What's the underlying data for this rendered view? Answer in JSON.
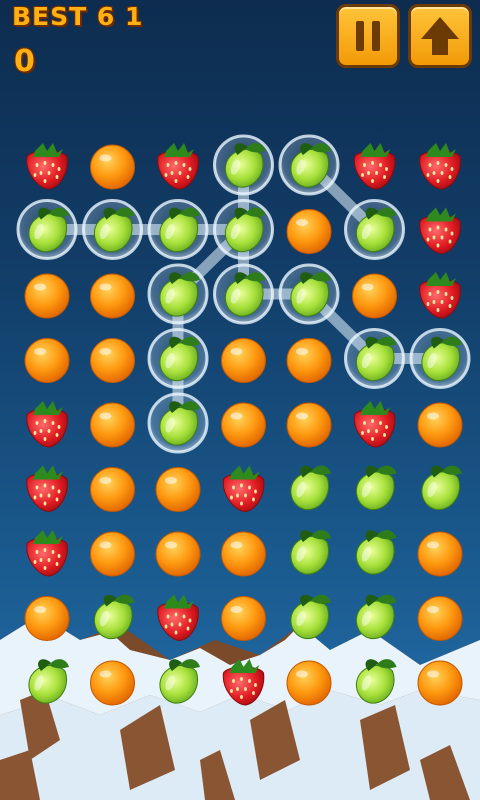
{
  "hud": {
    "best_label": "BEST 6 1",
    "score": "0",
    "pause_icon": "pause-icon",
    "up_icon": "up-arrow-icon"
  },
  "colors": {
    "accent": "#ffb114",
    "button": "#f29a07"
  },
  "board": {
    "rows": 9,
    "cols": 7,
    "grid": [
      [
        "strawberry",
        "orange",
        "strawberry",
        "lime",
        "lime",
        "strawberry",
        "strawberry"
      ],
      [
        "lime",
        "lime",
        "lime",
        "lime",
        "orange",
        "lime",
        "strawberry"
      ],
      [
        "orange",
        "orange",
        "lime",
        "lime",
        "lime",
        "orange",
        "strawberry"
      ],
      [
        "orange",
        "orange",
        "lime",
        "orange",
        "orange",
        "lime",
        "lime"
      ],
      [
        "strawberry",
        "orange",
        "lime",
        "orange",
        "orange",
        "strawberry",
        "orange"
      ],
      [
        "strawberry",
        "orange",
        "orange",
        "strawberry",
        "lime",
        "lime",
        "lime"
      ],
      [
        "strawberry",
        "orange",
        "orange",
        "orange",
        "lime",
        "lime",
        "orange"
      ],
      [
        "orange",
        "lime",
        "strawberry",
        "orange",
        "lime",
        "lime",
        "orange"
      ],
      [
        "lime",
        "orange",
        "lime",
        "strawberry",
        "orange",
        "lime",
        "orange"
      ]
    ],
    "selected": [
      [
        0,
        3
      ],
      [
        0,
        4
      ],
      [
        1,
        0
      ],
      [
        1,
        1
      ],
      [
        1,
        2
      ],
      [
        1,
        3
      ],
      [
        1,
        5
      ],
      [
        2,
        2
      ],
      [
        2,
        3
      ],
      [
        2,
        4
      ],
      [
        3,
        2
      ],
      [
        3,
        5
      ],
      [
        3,
        6
      ],
      [
        4,
        2
      ]
    ],
    "links": [
      [
        [
          1,
          0
        ],
        [
          1,
          1
        ]
      ],
      [
        [
          1,
          1
        ],
        [
          1,
          2
        ]
      ],
      [
        [
          1,
          2
        ],
        [
          1,
          3
        ]
      ],
      [
        [
          0,
          3
        ],
        [
          1,
          3
        ]
      ],
      [
        [
          0,
          4
        ],
        [
          1,
          5
        ]
      ],
      [
        [
          1,
          3
        ],
        [
          2,
          3
        ]
      ],
      [
        [
          1,
          3
        ],
        [
          2,
          2
        ]
      ],
      [
        [
          2,
          2
        ],
        [
          3,
          2
        ]
      ],
      [
        [
          3,
          2
        ],
        [
          4,
          2
        ]
      ],
      [
        [
          2,
          3
        ],
        [
          2,
          4
        ]
      ],
      [
        [
          2,
          4
        ],
        [
          3,
          5
        ]
      ],
      [
        [
          3,
          5
        ],
        [
          3,
          6
        ]
      ]
    ]
  }
}
